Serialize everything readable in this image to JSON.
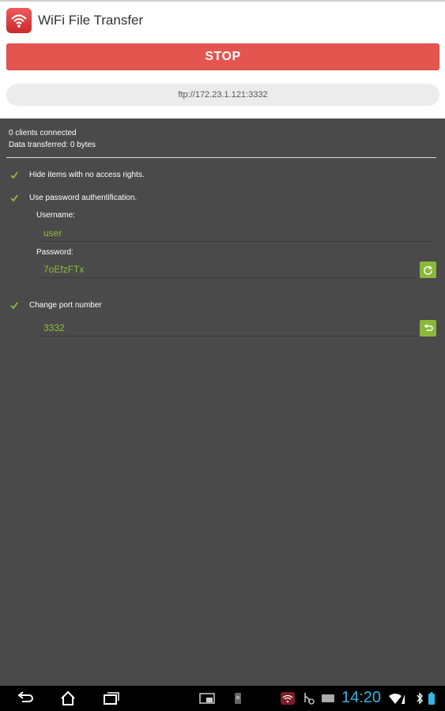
{
  "app": {
    "title": "WiFi File Transfer"
  },
  "actions": {
    "stop_label": "STOP"
  },
  "server": {
    "url": "ftp://172.23.1.121:3332"
  },
  "status": {
    "clients": "0 clients connected",
    "data": "Data transferred: 0 bytes"
  },
  "options": {
    "hide_items": {
      "label": "Hide items with no access rights.",
      "checked": true
    },
    "password_auth": {
      "label": "Use password authentification.",
      "checked": true
    },
    "username_label": "Username:",
    "username_value": "user",
    "password_label": "Password:",
    "password_value": "7oEfzFTx",
    "change_port": {
      "label": "Change port number",
      "checked": true
    },
    "port_value": "3332"
  },
  "system_bar": {
    "time": "14:20"
  },
  "colors": {
    "accent_red": "#e5554f",
    "accent_green": "#8ab83a",
    "clock_blue": "#33b5e5"
  },
  "icons": [
    "wifi-icon",
    "refresh-icon",
    "undo-icon",
    "back-icon",
    "home-icon",
    "recent-apps-icon",
    "screenshot-icon",
    "device-icon",
    "notification-icon",
    "usb-icon",
    "keyboard-icon",
    "signal-icon",
    "bluetooth-icon",
    "battery-icon"
  ]
}
